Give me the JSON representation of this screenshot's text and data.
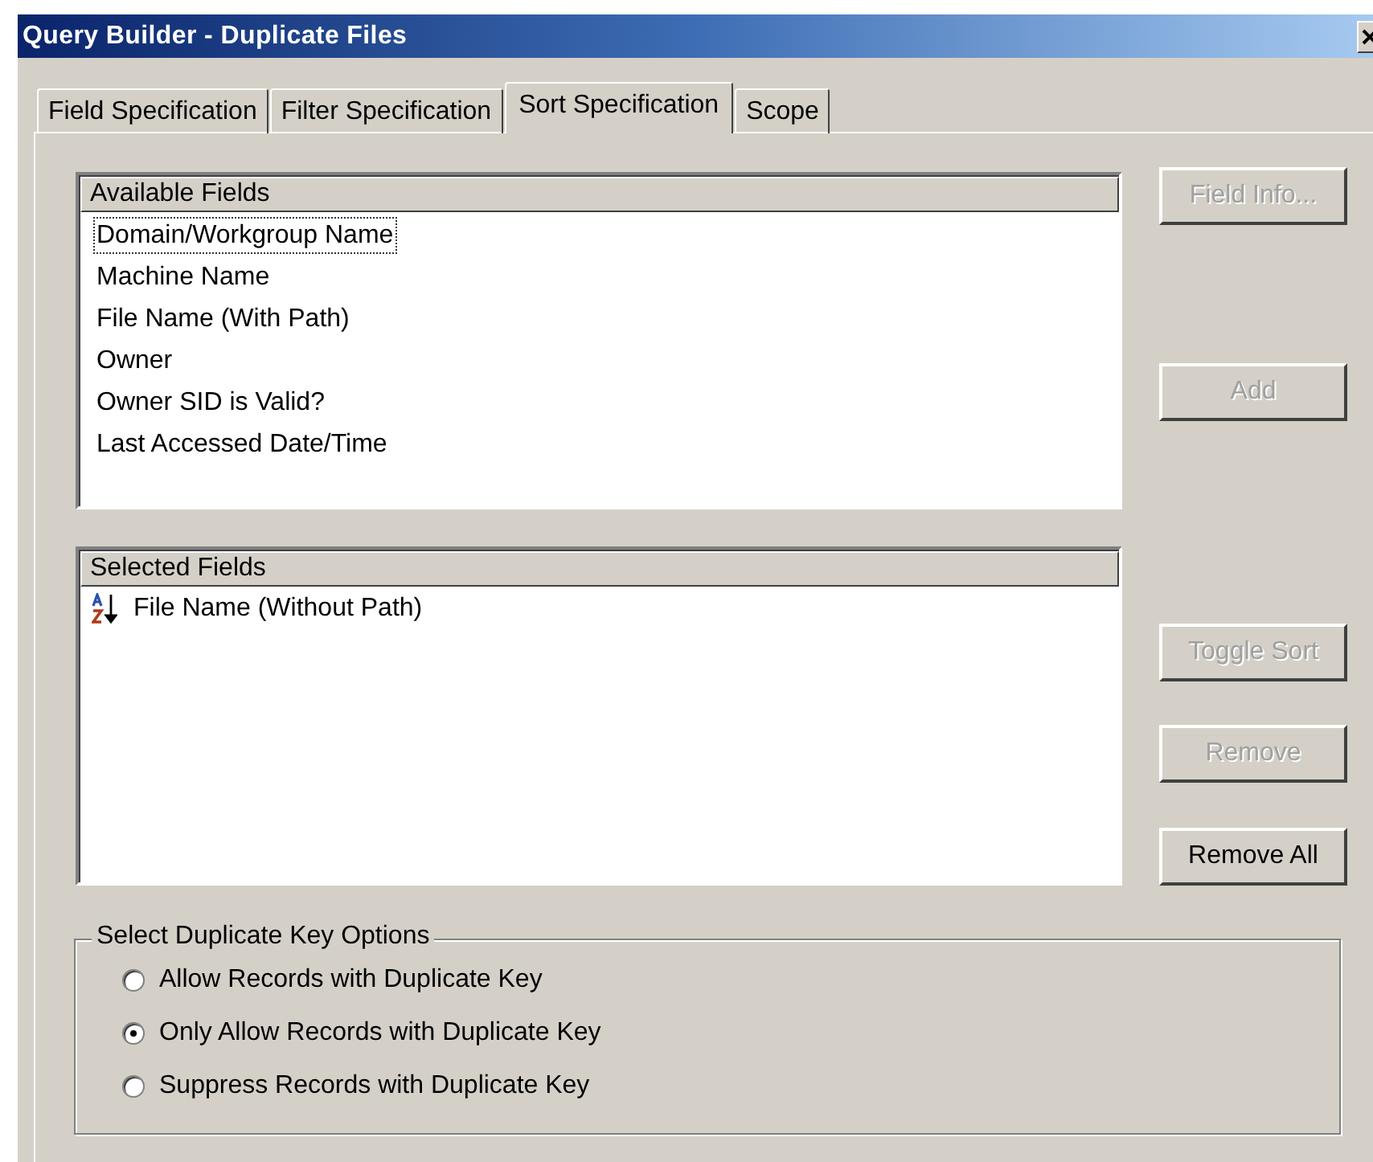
{
  "window": {
    "title": "Query Builder - Duplicate Files"
  },
  "tabs": [
    {
      "label": "Field Specification",
      "selected": false
    },
    {
      "label": "Filter Specification",
      "selected": false
    },
    {
      "label": "Sort Specification",
      "selected": true
    },
    {
      "label": "Scope",
      "selected": false
    }
  ],
  "available_fields": {
    "header": "Available Fields",
    "items": [
      {
        "label": "Domain/Workgroup Name",
        "focused": true
      },
      {
        "label": "Machine Name",
        "focused": false
      },
      {
        "label": "File Name (With Path)",
        "focused": false
      },
      {
        "label": "Owner",
        "focused": false
      },
      {
        "label": "Owner SID is Valid?",
        "focused": false
      },
      {
        "label": "Last Accessed Date/Time",
        "focused": false
      }
    ]
  },
  "selected_fields": {
    "header": "Selected Fields",
    "items": [
      {
        "label": "File Name (Without Path)",
        "ascending": true
      }
    ]
  },
  "buttons": [
    {
      "label": "Field Info...",
      "disabled": true
    },
    {
      "label": "Add",
      "disabled": true
    },
    {
      "label": "Toggle Sort",
      "disabled": true
    },
    {
      "label": "Remove",
      "disabled": true
    },
    {
      "label": "Remove All",
      "disabled": false
    }
  ],
  "duplicate_key_options": {
    "title": "Select Duplicate Key Options",
    "options": [
      {
        "label": "Allow Records with Duplicate Key",
        "selected": false
      },
      {
        "label": "Only Allow Records with Duplicate Key",
        "selected": true
      },
      {
        "label": "Suppress Records with Duplicate Key",
        "selected": false
      }
    ]
  }
}
